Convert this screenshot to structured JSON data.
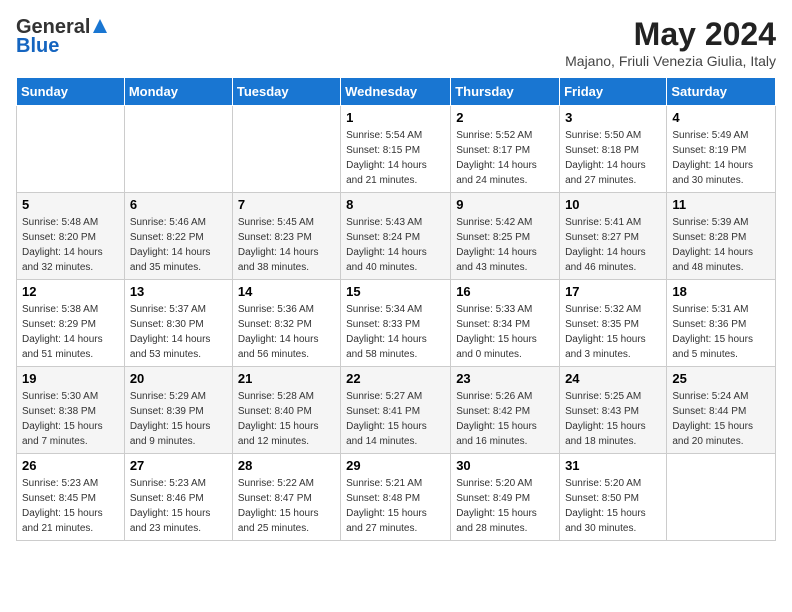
{
  "header": {
    "logo_general": "General",
    "logo_blue": "Blue",
    "month_title": "May 2024",
    "subtitle": "Majano, Friuli Venezia Giulia, Italy"
  },
  "weekdays": [
    "Sunday",
    "Monday",
    "Tuesday",
    "Wednesday",
    "Thursday",
    "Friday",
    "Saturday"
  ],
  "weeks": [
    [
      {
        "day": "",
        "info": ""
      },
      {
        "day": "",
        "info": ""
      },
      {
        "day": "",
        "info": ""
      },
      {
        "day": "1",
        "info": "Sunrise: 5:54 AM\nSunset: 8:15 PM\nDaylight: 14 hours\nand 21 minutes."
      },
      {
        "day": "2",
        "info": "Sunrise: 5:52 AM\nSunset: 8:17 PM\nDaylight: 14 hours\nand 24 minutes."
      },
      {
        "day": "3",
        "info": "Sunrise: 5:50 AM\nSunset: 8:18 PM\nDaylight: 14 hours\nand 27 minutes."
      },
      {
        "day": "4",
        "info": "Sunrise: 5:49 AM\nSunset: 8:19 PM\nDaylight: 14 hours\nand 30 minutes."
      }
    ],
    [
      {
        "day": "5",
        "info": "Sunrise: 5:48 AM\nSunset: 8:20 PM\nDaylight: 14 hours\nand 32 minutes."
      },
      {
        "day": "6",
        "info": "Sunrise: 5:46 AM\nSunset: 8:22 PM\nDaylight: 14 hours\nand 35 minutes."
      },
      {
        "day": "7",
        "info": "Sunrise: 5:45 AM\nSunset: 8:23 PM\nDaylight: 14 hours\nand 38 minutes."
      },
      {
        "day": "8",
        "info": "Sunrise: 5:43 AM\nSunset: 8:24 PM\nDaylight: 14 hours\nand 40 minutes."
      },
      {
        "day": "9",
        "info": "Sunrise: 5:42 AM\nSunset: 8:25 PM\nDaylight: 14 hours\nand 43 minutes."
      },
      {
        "day": "10",
        "info": "Sunrise: 5:41 AM\nSunset: 8:27 PM\nDaylight: 14 hours\nand 46 minutes."
      },
      {
        "day": "11",
        "info": "Sunrise: 5:39 AM\nSunset: 8:28 PM\nDaylight: 14 hours\nand 48 minutes."
      }
    ],
    [
      {
        "day": "12",
        "info": "Sunrise: 5:38 AM\nSunset: 8:29 PM\nDaylight: 14 hours\nand 51 minutes."
      },
      {
        "day": "13",
        "info": "Sunrise: 5:37 AM\nSunset: 8:30 PM\nDaylight: 14 hours\nand 53 minutes."
      },
      {
        "day": "14",
        "info": "Sunrise: 5:36 AM\nSunset: 8:32 PM\nDaylight: 14 hours\nand 56 minutes."
      },
      {
        "day": "15",
        "info": "Sunrise: 5:34 AM\nSunset: 8:33 PM\nDaylight: 14 hours\nand 58 minutes."
      },
      {
        "day": "16",
        "info": "Sunrise: 5:33 AM\nSunset: 8:34 PM\nDaylight: 15 hours\nand 0 minutes."
      },
      {
        "day": "17",
        "info": "Sunrise: 5:32 AM\nSunset: 8:35 PM\nDaylight: 15 hours\nand 3 minutes."
      },
      {
        "day": "18",
        "info": "Sunrise: 5:31 AM\nSunset: 8:36 PM\nDaylight: 15 hours\nand 5 minutes."
      }
    ],
    [
      {
        "day": "19",
        "info": "Sunrise: 5:30 AM\nSunset: 8:38 PM\nDaylight: 15 hours\nand 7 minutes."
      },
      {
        "day": "20",
        "info": "Sunrise: 5:29 AM\nSunset: 8:39 PM\nDaylight: 15 hours\nand 9 minutes."
      },
      {
        "day": "21",
        "info": "Sunrise: 5:28 AM\nSunset: 8:40 PM\nDaylight: 15 hours\nand 12 minutes."
      },
      {
        "day": "22",
        "info": "Sunrise: 5:27 AM\nSunset: 8:41 PM\nDaylight: 15 hours\nand 14 minutes."
      },
      {
        "day": "23",
        "info": "Sunrise: 5:26 AM\nSunset: 8:42 PM\nDaylight: 15 hours\nand 16 minutes."
      },
      {
        "day": "24",
        "info": "Sunrise: 5:25 AM\nSunset: 8:43 PM\nDaylight: 15 hours\nand 18 minutes."
      },
      {
        "day": "25",
        "info": "Sunrise: 5:24 AM\nSunset: 8:44 PM\nDaylight: 15 hours\nand 20 minutes."
      }
    ],
    [
      {
        "day": "26",
        "info": "Sunrise: 5:23 AM\nSunset: 8:45 PM\nDaylight: 15 hours\nand 21 minutes."
      },
      {
        "day": "27",
        "info": "Sunrise: 5:23 AM\nSunset: 8:46 PM\nDaylight: 15 hours\nand 23 minutes."
      },
      {
        "day": "28",
        "info": "Sunrise: 5:22 AM\nSunset: 8:47 PM\nDaylight: 15 hours\nand 25 minutes."
      },
      {
        "day": "29",
        "info": "Sunrise: 5:21 AM\nSunset: 8:48 PM\nDaylight: 15 hours\nand 27 minutes."
      },
      {
        "day": "30",
        "info": "Sunrise: 5:20 AM\nSunset: 8:49 PM\nDaylight: 15 hours\nand 28 minutes."
      },
      {
        "day": "31",
        "info": "Sunrise: 5:20 AM\nSunset: 8:50 PM\nDaylight: 15 hours\nand 30 minutes."
      },
      {
        "day": "",
        "info": ""
      }
    ]
  ]
}
